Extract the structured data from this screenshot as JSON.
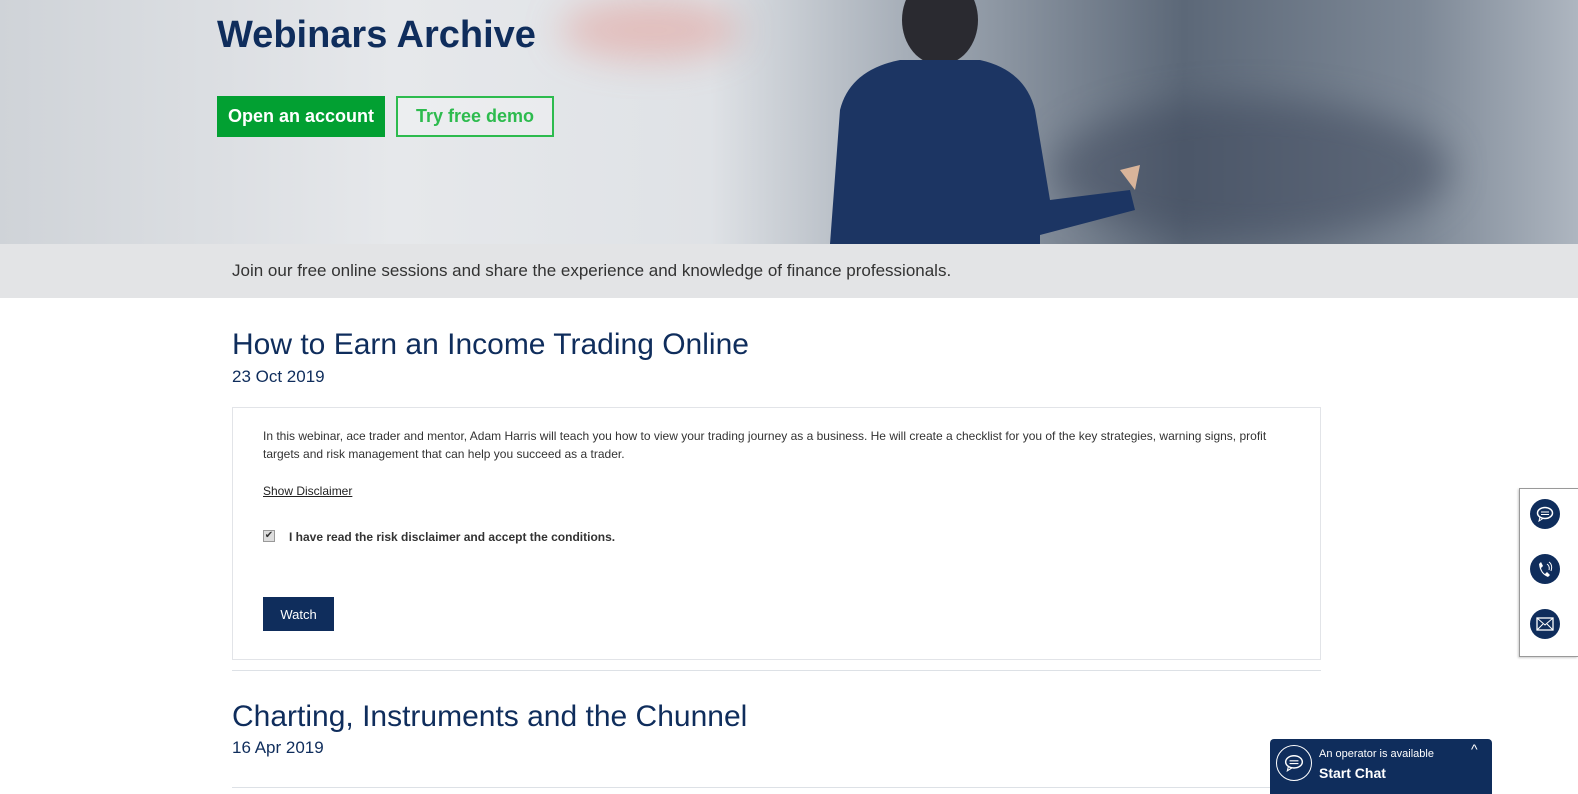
{
  "hero": {
    "title": "Webinars Archive",
    "open_account": "Open an account",
    "try_demo": "Try free demo"
  },
  "intro": "Join our free online sessions and share the experience and knowledge of finance professionals.",
  "webinars": [
    {
      "title": "How to Earn an Income Trading Online",
      "date": "23 Oct 2019",
      "description": "In this webinar, ace trader and mentor, Adam Harris will teach you how to view your trading journey as a business.  He will create a checklist for you of the key strategies, warning signs, profit targets and risk management that can help you succeed as a trader.",
      "show_disclaimer": "Show Disclaimer",
      "accept_label": "I have read the risk disclaimer and accept the conditions.",
      "accepted": true,
      "watch": "Watch"
    },
    {
      "title": "Charting, Instruments and the Chunnel",
      "date": "16 Apr 2019"
    }
  ],
  "chat": {
    "status": "An operator is available",
    "action": "Start Chat"
  },
  "colors": {
    "navy": "#0f2d5c",
    "green": "#02a032"
  }
}
